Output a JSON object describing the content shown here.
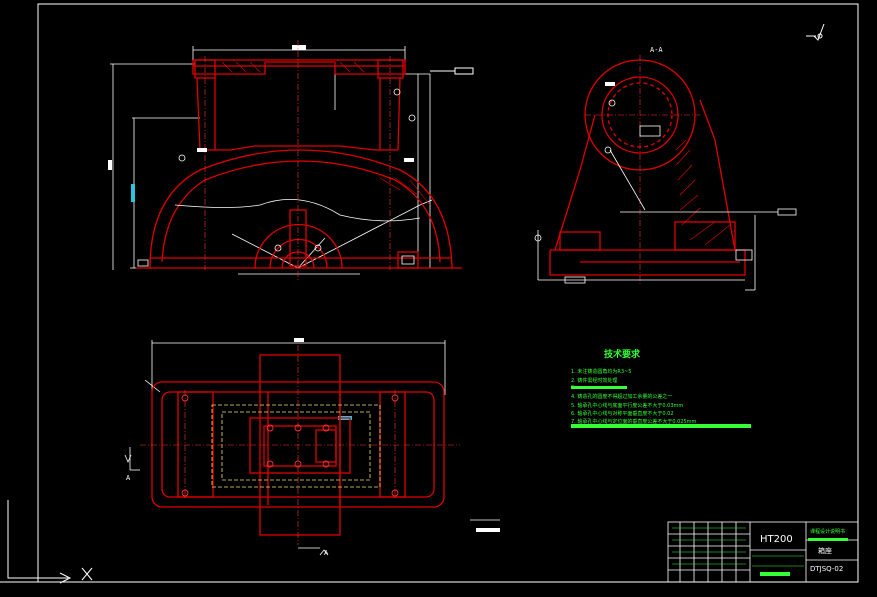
{
  "colors": {
    "background": "#000000",
    "outline": "#e00000",
    "dimension": "#ffffff",
    "centerline": "#ff3030",
    "hidden": "#f5e06a",
    "text_green": "#36ff36",
    "cyan": "#29c6e0",
    "frame": "#ffffff"
  },
  "views": {
    "section_label": "A-A",
    "section_arrow_label": "A"
  },
  "tech_requirements": {
    "title": "技术要求",
    "items": [
      "1. 未注铸造圆角均为R3~5",
      "2. 铸件需经时效处理",
      "3. ",
      "4. 铸造孔的圆度不得超过加工余量的公差之一",
      "5. 轴承孔中心线与底面平行度公差不大于0.03mm",
      "6. 轴承孔中心线与对称平面垂直度不大于0.02",
      "7. 轴承孔中心线与定位面的垂直度公差不大于0.025mm"
    ]
  },
  "title_block": {
    "material": "HT200",
    "name": "箱座",
    "drawing_no": "DTJSQ-02",
    "school": "课程设计说明书"
  },
  "icons": {
    "roughness": "roughness-symbol-icon",
    "coords": "ucs-icon"
  }
}
